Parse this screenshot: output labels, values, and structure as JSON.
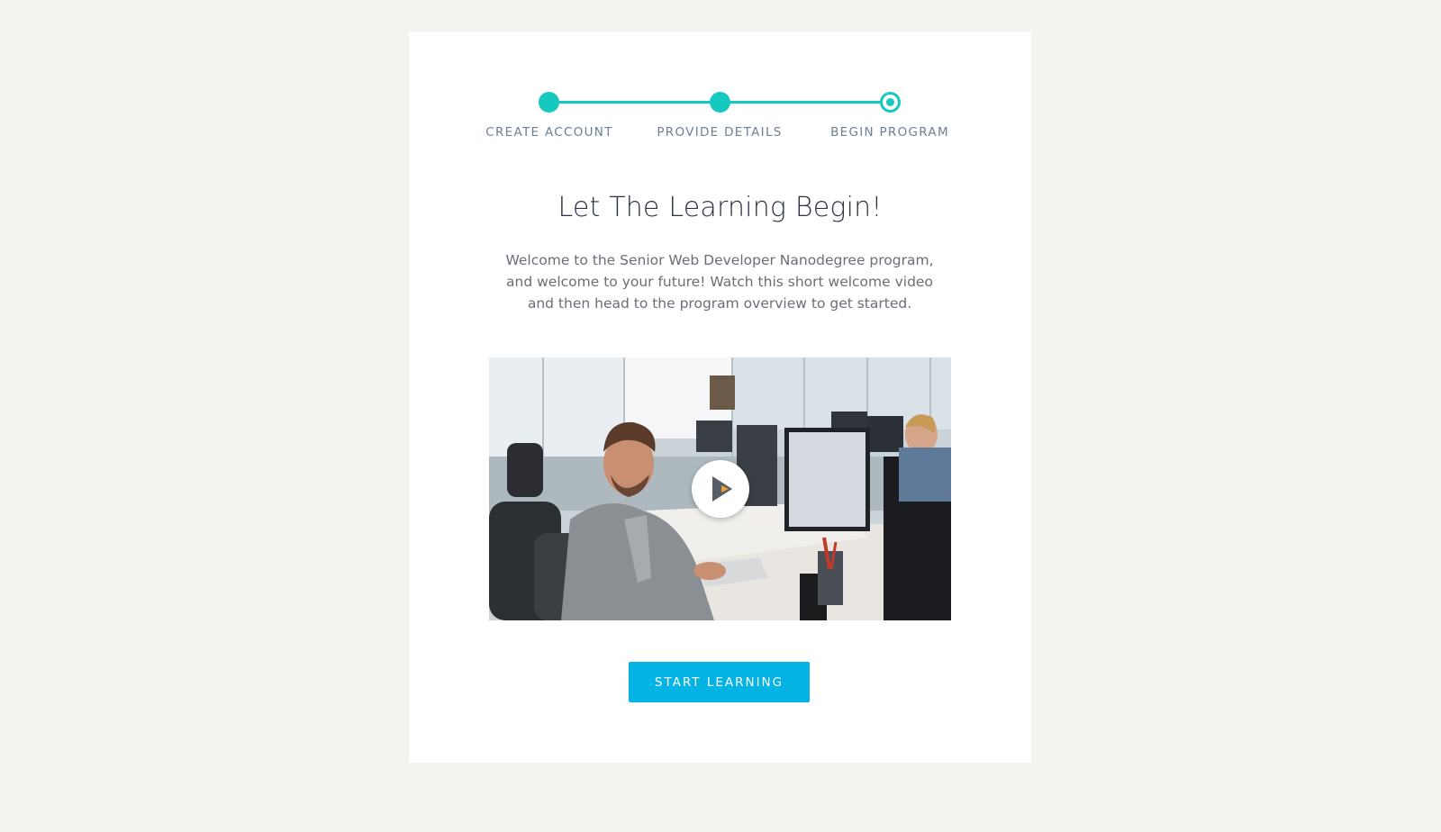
{
  "stepper": {
    "steps": [
      {
        "label": "CREATE ACCOUNT",
        "state": "complete"
      },
      {
        "label": "PROVIDE DETAILS",
        "state": "complete"
      },
      {
        "label": "BEGIN PROGRAM",
        "state": "current"
      }
    ],
    "accent_color": "#15c8c0"
  },
  "main": {
    "title": "Let The Learning Begin!",
    "intro": "Welcome to the Senior Web Developer Nanodegree program, and welcome to your future! Watch this short welcome video and then head to the program overview to get started.",
    "start_button_label": "START LEARNING",
    "button_color": "#02b3e4"
  },
  "video": {
    "play_icon": "play-icon"
  }
}
